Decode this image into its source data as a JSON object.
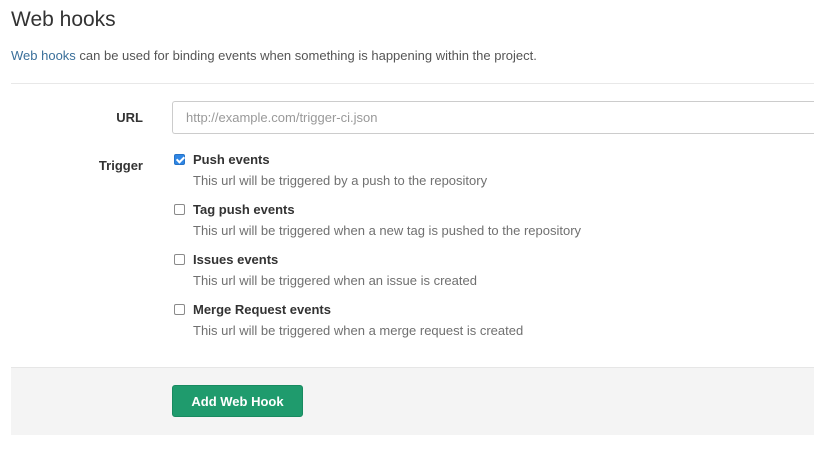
{
  "header": {
    "title": "Web hooks"
  },
  "description": {
    "link_text": "Web hooks",
    "text": " can be used for binding events when something is happening within the project."
  },
  "form": {
    "url": {
      "label": "URL",
      "value": "",
      "placeholder": "http://example.com/trigger-ci.json"
    },
    "trigger": {
      "label": "Trigger",
      "items": [
        {
          "title": "Push events",
          "help": "This url will be triggered by a push to the repository",
          "checked": true
        },
        {
          "title": "Tag push events",
          "help": "This url will be triggered when a new tag is pushed to the repository",
          "checked": false
        },
        {
          "title": "Issues events",
          "help": "This url will be triggered when an issue is created",
          "checked": false
        },
        {
          "title": "Merge Request events",
          "help": "This url will be triggered when a merge request is created",
          "checked": false
        }
      ]
    },
    "submit_label": "Add Web Hook"
  },
  "colors": {
    "accent_button": "#1f9b6d",
    "checkbox_checked": "#2f86e4",
    "link": "#3a6f9a"
  }
}
